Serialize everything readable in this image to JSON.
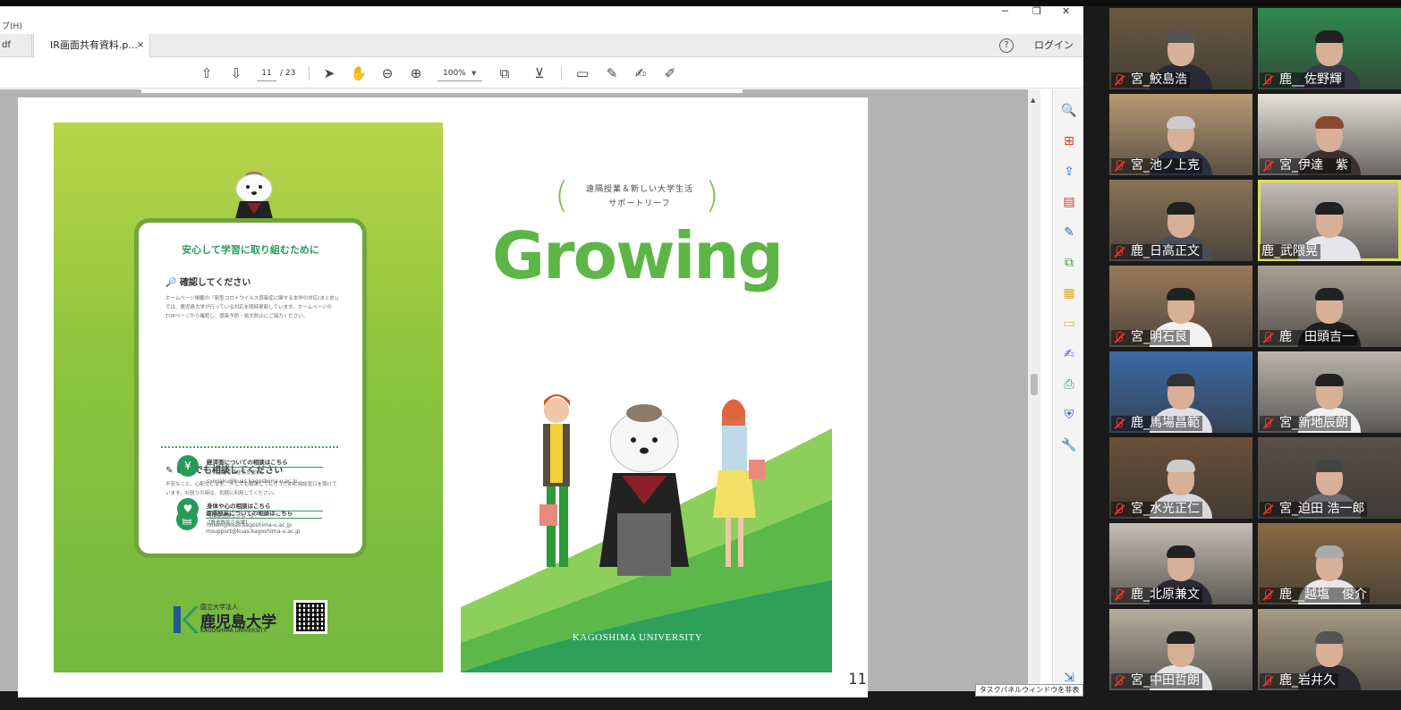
{
  "pdf_window": {
    "menu_fragment": "プ(H)",
    "tabs": [
      {
        "label": "df"
      },
      {
        "label": "IR画面共有資料.p...",
        "close": "×"
      }
    ],
    "help": "?",
    "login_label": "ログイン",
    "toolbar": {
      "current_page": "11",
      "total_pages": "/ 23",
      "zoom": "100%"
    },
    "hide_panel_tooltip": "タスクパネルウィンドウを非表示",
    "page_number": "11"
  },
  "document": {
    "notice_title": "安心して学習に取り組むために",
    "section1_heading": "確認してください",
    "section1_text": "ホームページ掲載の「新型コロナウイルス感染症に関する本学の対応(まとめ)」では、鹿児島大学が行っている対応を随時更新しています。ホームページのTOPページから確認し、感染予防・拡大防止にご協力ください。",
    "section2_heading": "いつでも相談してください",
    "section2_text": "不安なこと、心配なことを、少しでも解決してもらうために相談窓口を設けています。お困りの時は、気軽に利用してください。",
    "contacts": [
      {
        "title": "遠隔授業についての相談はこちら",
        "dept": "【教員教育企画課】",
        "email": "msupport@kuas.kagoshima-u.ac.jp",
        "icon": "book-icon",
        "glyph": "▤"
      },
      {
        "title": "経済面についての相談はこちら",
        "dept": "【学生生活課経済支援係】",
        "email": "syogaku@kuas.kagoshima-u.ac.jp",
        "icon": "yen-icon",
        "glyph": "¥"
      },
      {
        "title": "身体や心の相談はこちら",
        "dept": "【保健管理センター】",
        "email": "hoken@kuas.kagoshima-u.ac.jp",
        "icon": "heart-icon",
        "glyph": "♥"
      }
    ],
    "logo_small": "国立大学法人",
    "logo_main": "鹿児島大学",
    "logo_en": "KAGOSHIMA UNIVERSITY",
    "tagline_line1": "遠隔授業＆新しい大学生活",
    "tagline_line2": "サポートリーフ",
    "cover_title": "Growing",
    "cover_footer": "KAGOSHIMA UNIVERSITY"
  },
  "participants": [
    {
      "name": "宮_鮫島浩",
      "bg": "#6b5a3f",
      "shirt": "#2a2a35",
      "hair": "#555"
    },
    {
      "name": "鹿__佐野輝",
      "bg": "#2f8a4e",
      "shirt": "#3a3a48",
      "hair": "#222"
    },
    {
      "name": "宮_池ノ上克",
      "bg": "#b99a72",
      "shirt": "#2c3040",
      "hair": "#ccc"
    },
    {
      "name": "宮_伊達　紫",
      "bg": "#e6e1da",
      "shirt": "#3a3030",
      "hair": "#8a4a30"
    },
    {
      "name": "鹿_日高正文",
      "bg": "#8a7356",
      "shirt": "#4a4e5a",
      "hair": "#222"
    },
    {
      "name": "鹿_武隈晃",
      "bg": "#c8c2b8",
      "shirt": "#e5e5ea",
      "hair": "#222"
    },
    {
      "name": "宮_明石良",
      "bg": "#9a7a5a",
      "shirt": "#f2f2f2",
      "hair": "#222"
    },
    {
      "name": "鹿　田頭吉一",
      "bg": "#a8a092",
      "shirt": "#202020",
      "hair": "#222"
    },
    {
      "name": "鹿_馬場昌範",
      "bg": "#3a6aa8",
      "shirt": "#e0e0e8",
      "hair": "#333"
    },
    {
      "name": "宮_新地辰朗",
      "bg": "#b9b5ad",
      "shirt": "#f0f0f0",
      "hair": "#222"
    },
    {
      "name": "宮_水光正仁",
      "bg": "#6a5038",
      "shirt": "#d8d8dc",
      "hair": "#ccc"
    },
    {
      "name": "宮_迫田 浩一郎",
      "bg": "#5a5048",
      "shirt": "#6a6a70",
      "hair": "#444"
    },
    {
      "name": "鹿_北原兼文",
      "bg": "#c4beb4",
      "shirt": "#2a2a36",
      "hair": "#222"
    },
    {
      "name": "鹿__越塩　俊介",
      "bg": "#8a6a44",
      "shirt": "#e8e8e8",
      "hair": "#aaa"
    },
    {
      "name": "宮_中田哲朗",
      "bg": "#b4ae9c",
      "shirt": "#e4e4e8",
      "hair": "#222"
    },
    {
      "name": "鹿_岩井久",
      "bg": "#a89c84",
      "shirt": "#2a2a30",
      "hair": "#555"
    }
  ],
  "colors": {
    "accent_green": "#5cb545",
    "dark_green": "#2a9a5a",
    "speaker_highlight": "#d9e05a",
    "muted_red": "#e33333"
  }
}
